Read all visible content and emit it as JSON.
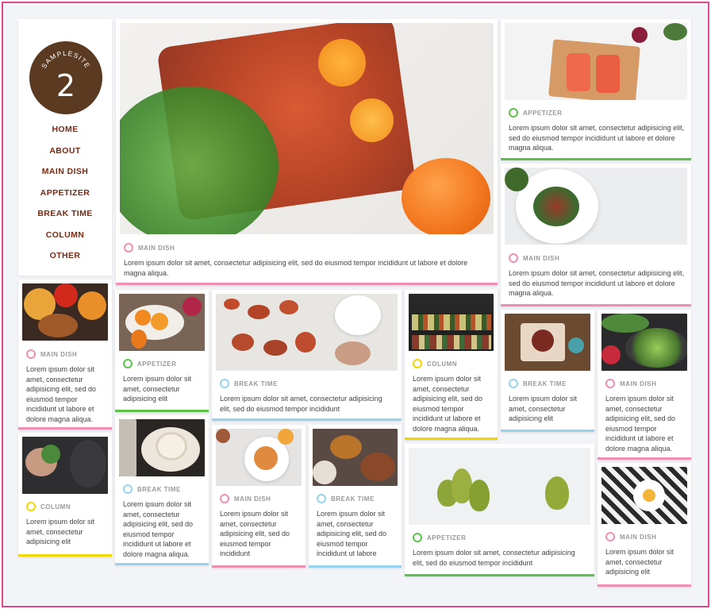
{
  "logo": {
    "arc_text": "SAMPLESITE",
    "number": "2"
  },
  "nav": [
    "HOME",
    "ABOUT",
    "MAIN DISH",
    "APPETIZER",
    "BREAK TIME",
    "COLUMN",
    "OTHER"
  ],
  "colors": {
    "frame": "#e0498e",
    "nav_text": "#7a2a13",
    "logo_bg": "#5b3a22",
    "main_dish": "#f08fb4",
    "appetizer": "#5cc24a",
    "break_time": "#96d3ee",
    "column": "#f1d600"
  },
  "cards": {
    "hero": {
      "category": "MAIN DISH",
      "text": "Lorem ipsum dolor sit amet, consectetur adipisicing elit, sed do eiusmod tempor incididunt ut labore et dolore magna aliqua."
    },
    "salmon": {
      "category": "APPETIZER",
      "text": "Lorem ipsum dolor sit amet, consectetur adipisicing elit, sed do eiusmod tempor incididunt ut labore et dolore magna aliqua."
    },
    "salad_plate": {
      "category": "MAIN DISH",
      "text": "Lorem ipsum dolor sit amet, consectetur adipisicing elit, sed do eiusmod tempor incididunt ut labore et dolore magna aliqua."
    },
    "veggies": {
      "category": "MAIN DISH",
      "text": "Lorem ipsum dolor sit amet, consectetur adipisicing elit, sed do eiusmod tempor incididunt ut labore et dolore magna aliqua."
    },
    "fruit_bowl": {
      "category": "APPETIZER",
      "text": "Lorem ipsum dolor sit amet, consectetur adipisicing elit"
    },
    "cookies": {
      "category": "BREAK TIME",
      "text": "Lorem ipsum dolor sit amet, consectetur adipisicing elit, sed do eiusmod tempor incididunt"
    },
    "shelves": {
      "category": "COLUMN",
      "text": "Lorem ipsum dolor sit amet, consectetur adipisicing elit, sed do eiusmod tempor incididunt ut labore et dolore magna aliqua."
    },
    "coffee_top": {
      "category": "BREAK TIME",
      "text": "Lorem ipsum dolor sit amet, consectetur adipisicing elit"
    },
    "pan": {
      "category": "MAIN DISH",
      "text": "Lorem ipsum dolor sit amet, consectetur adipisicing elit, sed do eiusmod tempor incididunt ut labore et dolore magna aliqua."
    },
    "herbs_hand": {
      "category": "COLUMN",
      "text": "Lorem ipsum dolor sit amet, consectetur adipisicing elit"
    },
    "cup": {
      "category": "BREAK TIME",
      "text": "Lorem ipsum dolor sit amet, consectetur adipisicing elit, sed do eiusmod tempor incididunt ut labore et dolore magna aliqua."
    },
    "plate_food": {
      "category": "MAIN DISH",
      "text": "Lorem ipsum dolor sit amet, consectetur adipisicing elit, sed do eiusmod tempor incididunt"
    },
    "burger": {
      "category": "BREAK TIME",
      "text": "Lorem ipsum dolor sit amet, consectetur adipisicing elit, sed do eiusmod tempor incididunt ut labore"
    },
    "pears": {
      "category": "APPETIZER",
      "text": "Lorem ipsum dolor sit amet, consectetur adipisicing elit, sed do eiusmod tempor incididunt"
    },
    "egg": {
      "category": "MAIN DISH",
      "text": "Lorem ipsum dolor sit amet, consectetur adipisicing elit"
    }
  }
}
